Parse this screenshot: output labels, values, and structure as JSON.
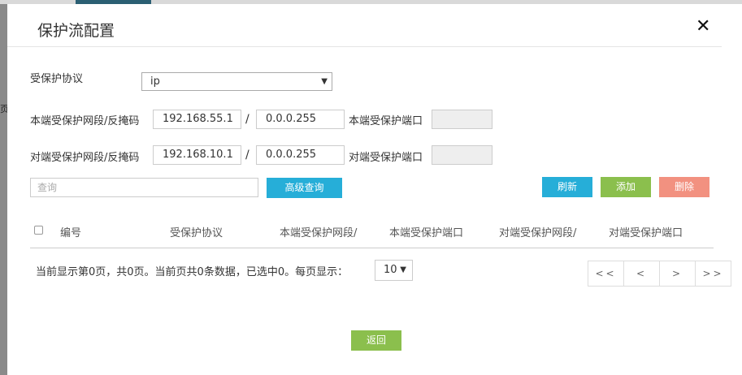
{
  "background": {
    "side_text": "页"
  },
  "dialog": {
    "title": "保护流配置",
    "close": "✕"
  },
  "form": {
    "protocol_label": "受保护协议",
    "protocol_value": "ip",
    "local_label": "本端受保护网段/反掩码",
    "local_ip": "192.168.55.1",
    "local_mask": "0.0.0.255",
    "local_port_label": "本端受保护端口",
    "local_port": "",
    "remote_label": "对端受保护网段/反掩码",
    "remote_ip": "192.168.10.1",
    "remote_mask": "0.0.0.255",
    "remote_port_label": "对端受保护端口",
    "remote_port": "",
    "slash": "/"
  },
  "toolbar": {
    "search_placeholder": "查询",
    "advanced_query": "高级查询",
    "refresh": "刷新",
    "add": "添加",
    "delete": "删除"
  },
  "table": {
    "columns": [
      "编号",
      "受保护协议",
      "本端受保护网段/",
      "本端受保护端口",
      "对端受保护网段/",
      "对端受保护端口"
    ]
  },
  "footer": {
    "status": "当前显示第0页，共0页。当前页共0条数据，已选中0。每页显示：",
    "page_size": "10",
    "pager": [
      "<<",
      "<",
      ">",
      ">>"
    ],
    "back": "返回"
  },
  "colors": {
    "blue": "#26aed8",
    "green": "#8bbf4d",
    "red": "#f29180"
  }
}
